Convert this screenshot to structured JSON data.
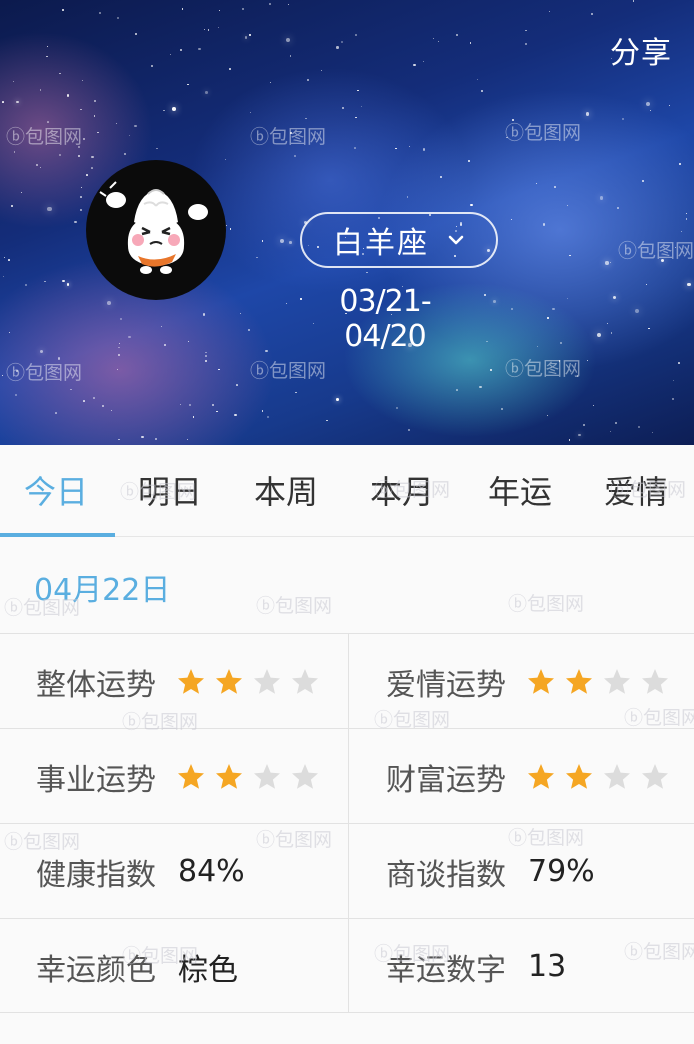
{
  "header": {
    "share_label": "分享",
    "sign": "白羊座",
    "date_range": "03/21-04/20"
  },
  "tabs": [
    {
      "label": "今日",
      "active": true
    },
    {
      "label": "明日"
    },
    {
      "label": "本周"
    },
    {
      "label": "本月"
    },
    {
      "label": "年运"
    },
    {
      "label": "爱情"
    }
  ],
  "content": {
    "date": "04月22日",
    "rows": [
      {
        "left": {
          "label": "整体运势",
          "stars": 2,
          "max": 4
        },
        "right": {
          "label": "爱情运势",
          "stars": 2,
          "max": 4
        }
      },
      {
        "left": {
          "label": "事业运势",
          "stars": 2,
          "max": 4
        },
        "right": {
          "label": "财富运势",
          "stars": 2,
          "max": 4
        }
      },
      {
        "left": {
          "label": "健康指数",
          "value": "84%"
        },
        "right": {
          "label": "商谈指数",
          "value": "79%"
        }
      },
      {
        "left": {
          "label": "幸运颜色",
          "value": "棕色"
        },
        "right": {
          "label": "幸运数字",
          "value": "13"
        }
      }
    ]
  },
  "watermark": "包图网",
  "colors": {
    "accent": "#5aaee0",
    "star_on": "#f5a623",
    "star_off": "#dcdcdc"
  }
}
